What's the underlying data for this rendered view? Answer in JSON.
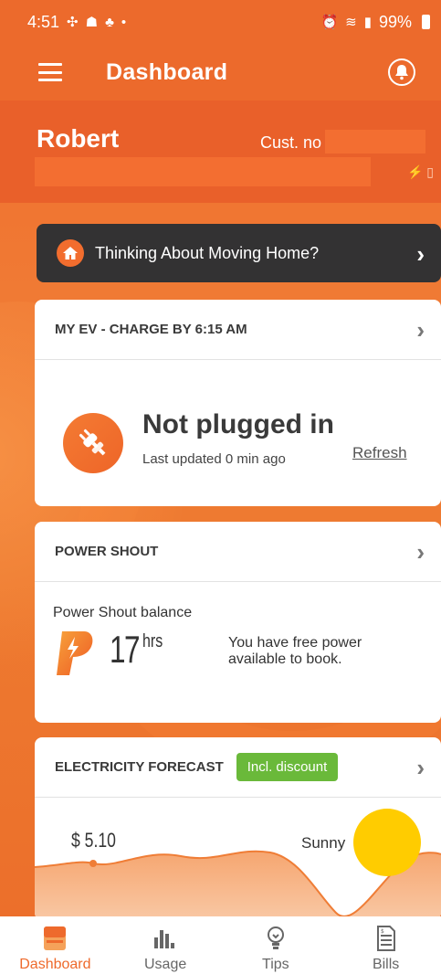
{
  "status_bar": {
    "time": "4:51",
    "left_icons": [
      "slack-icon",
      "cat-icon",
      "bird-icon",
      "dot-icon"
    ],
    "right_icons": [
      "alarm-icon",
      "wifi-icon",
      "volte-icon",
      "signal-icon"
    ],
    "battery": "99%"
  },
  "appbar": {
    "title": "Dashboard"
  },
  "customer": {
    "name": "Robert",
    "cust_no_label": "Cust. no"
  },
  "banner": {
    "text": "Thinking About Moving Home?"
  },
  "ev_card": {
    "title": "MY EV - CHARGE BY 6:15 AM",
    "status": "Not plugged in",
    "updated": "Last updated 0 min ago",
    "refresh": "Refresh"
  },
  "power_shout": {
    "title": "POWER SHOUT",
    "balance_label": "Power Shout balance",
    "hours": "17",
    "unit": "hrs",
    "message": "You have free power available to book."
  },
  "forecast": {
    "title": "ELECTRICITY FORECAST",
    "badge": "Incl. discount",
    "price": "$ 5.10",
    "weather": "Sunny"
  },
  "bottom_nav": {
    "items": [
      {
        "label": "Dashboard",
        "icon": "dashboard-icon",
        "active": true
      },
      {
        "label": "Usage",
        "icon": "bar-chart-icon",
        "active": false
      },
      {
        "label": "Tips",
        "icon": "lightbulb-icon",
        "active": false
      },
      {
        "label": "Bills",
        "icon": "bill-icon",
        "active": false
      }
    ]
  },
  "colors": {
    "brand_orange": "#ee6a2c",
    "banner_dark": "#333233",
    "badge_green": "#6ab93a",
    "sun_yellow": "#ffcc00"
  }
}
